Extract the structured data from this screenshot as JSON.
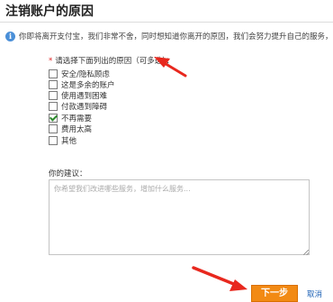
{
  "page": {
    "title": "注销账户的原因",
    "notice": "你即将离开支付宝，我们非常不舍，同时想知道你离开的原因，我们会努力提升自己的服务，期待你再次使用"
  },
  "reasons": {
    "prompt": "请选择下面列出的原因（可多选）：",
    "required_mark": "*",
    "options": [
      {
        "label": "安全/隐私顾虑",
        "checked": false
      },
      {
        "label": "这是多余的账户",
        "checked": false
      },
      {
        "label": "使用遇到困难",
        "checked": false
      },
      {
        "label": "付款遇到障碍",
        "checked": false
      },
      {
        "label": "不再需要",
        "checked": true
      },
      {
        "label": "费用太高",
        "checked": false
      },
      {
        "label": "其他",
        "checked": false
      }
    ]
  },
  "suggestion": {
    "label": "你的建议：",
    "placeholder": "你希望我们改进哪些服务，增加什么服务...",
    "value": ""
  },
  "actions": {
    "next_label": "下一步",
    "cancel_label": "取消"
  },
  "colors": {
    "accent_orange": "#f28a14",
    "required_red": "#e02020",
    "annotation_arrow_red": "#e8281e",
    "link_blue": "#1a5fb4",
    "info_blue": "#4a8fd8"
  },
  "icons": {
    "info": "info-icon",
    "check": "checkmark-icon"
  }
}
